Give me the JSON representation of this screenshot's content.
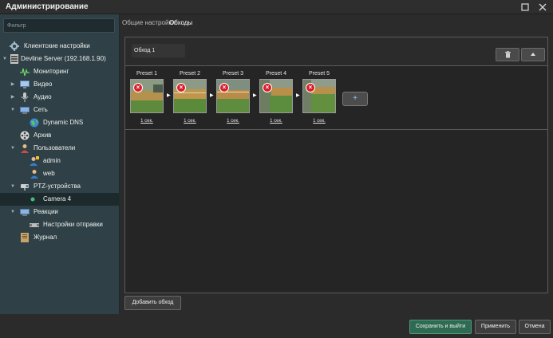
{
  "window": {
    "title": "Администрирование",
    "icons": {
      "maximize": "maximize-icon",
      "close": "close-icon"
    }
  },
  "sidebar": {
    "filter_placeholder": "Фильтр",
    "items": [
      {
        "label": "Клиентские настройки",
        "icon": "gear-icon"
      },
      {
        "label": "Devline Server (192.168.1.90)",
        "icon": "server-icon"
      },
      {
        "label": "Мониторинг",
        "icon": "pulse-icon"
      },
      {
        "label": "Видео",
        "icon": "monitor-icon"
      },
      {
        "label": "Аудио",
        "icon": "microphone-icon"
      },
      {
        "label": "Сеть",
        "icon": "network-icon"
      },
      {
        "label": "Dynamic DNS",
        "icon": "globe-icon"
      },
      {
        "label": "Архив",
        "icon": "film-reel-icon"
      },
      {
        "label": "Пользователи",
        "icon": "users-icon"
      },
      {
        "label": "admin",
        "icon": "admin-user-icon"
      },
      {
        "label": "web",
        "icon": "web-user-icon"
      },
      {
        "label": "PTZ-устройства",
        "icon": "ptz-icon"
      },
      {
        "label": "Camera 4",
        "icon": "camera-dot-icon"
      },
      {
        "label": "Реакции",
        "icon": "reactions-icon"
      },
      {
        "label": "Настройки отправки",
        "icon": "send-settings-icon"
      },
      {
        "label": "Журнал",
        "icon": "journal-icon"
      }
    ]
  },
  "tabs": [
    {
      "label": "Общие настройки"
    },
    {
      "label": "Обходы"
    }
  ],
  "route": {
    "name": "Обход 1",
    "delete_icon": "trash-icon",
    "collapse_icon": "arrow-up-icon"
  },
  "presets": [
    {
      "name": "Preset 1",
      "duration": "1 сек."
    },
    {
      "name": "Preset 2",
      "duration": "1 сек."
    },
    {
      "name": "Preset 3",
      "duration": "1 сек."
    },
    {
      "name": "Preset 4",
      "duration": "1 сек."
    },
    {
      "name": "Preset 5",
      "duration": "1 сек."
    }
  ],
  "add_preset_label": "+",
  "buttons": {
    "add_route": "Добавить обход",
    "save_exit": "Сохранить и выйти",
    "apply": "Применить",
    "cancel": "Отмена"
  },
  "colors": {
    "sidebar_bg": "#2f4146",
    "accent_green": "#2f6a52",
    "error_red": "#d91f2a"
  }
}
